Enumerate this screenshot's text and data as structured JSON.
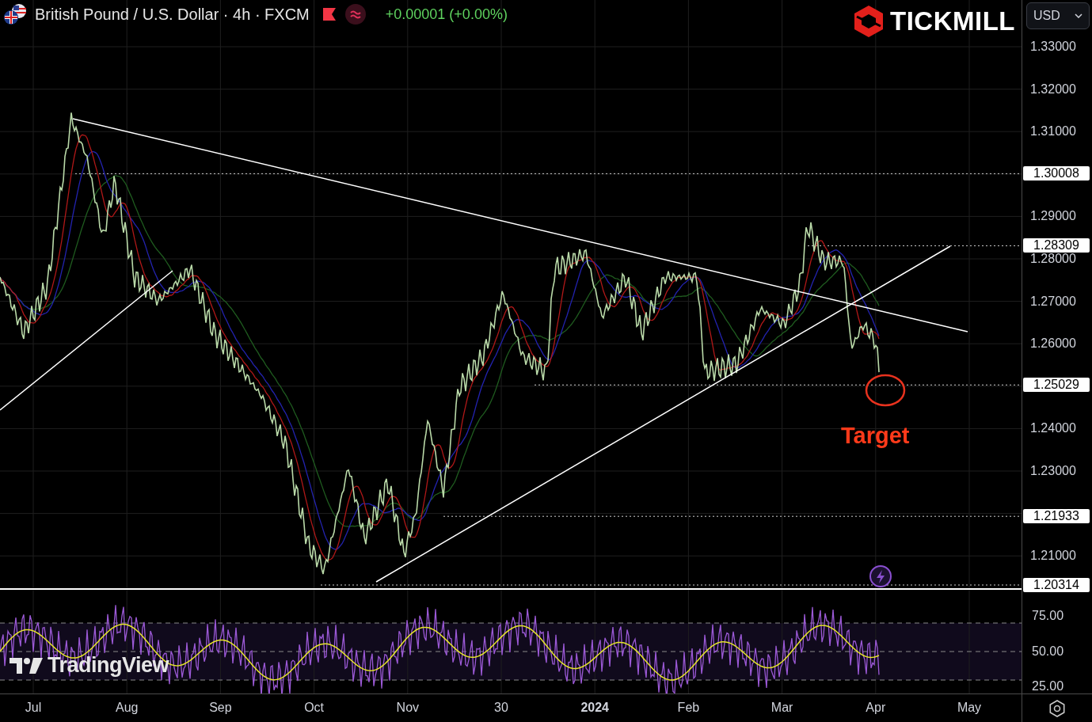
{
  "header": {
    "symbol": "British Pound / U.S. Dollar · 4h · FXCM",
    "change": "+0.00001 (+0.00%)"
  },
  "broker_logo": {
    "name": "TICKMILL"
  },
  "currency_select": {
    "value": "USD"
  },
  "price_axis": {
    "ticks": [
      "1.33000",
      "1.32000",
      "1.31000",
      "1.29000",
      "1.28000",
      "1.27000",
      "1.26000",
      "1.24000",
      "1.23000",
      "1.21000"
    ]
  },
  "levels": [
    {
      "label": "1.30008"
    },
    {
      "label": "1.28309"
    },
    {
      "label": "1.25029"
    },
    {
      "label": "1.21933"
    },
    {
      "label": "1.20314"
    }
  ],
  "annotation": {
    "label": "Target"
  },
  "rsi_axis": {
    "ticks": [
      "75.00",
      "50.00",
      "25.00"
    ]
  },
  "time_axis": {
    "labels": [
      {
        "label": "Jul",
        "kind": "month"
      },
      {
        "label": "Aug",
        "kind": "month"
      },
      {
        "label": "Sep",
        "kind": "month"
      },
      {
        "label": "Oct",
        "kind": "month"
      },
      {
        "label": "Nov",
        "kind": "month"
      },
      {
        "label": "30",
        "kind": "month"
      },
      {
        "label": "2024",
        "kind": "year"
      },
      {
        "label": "Feb",
        "kind": "month"
      },
      {
        "label": "Mar",
        "kind": "month"
      },
      {
        "label": "Apr",
        "kind": "month"
      },
      {
        "label": "May",
        "kind": "month"
      }
    ]
  },
  "watermark_logo": {
    "name": "TradingView"
  }
}
